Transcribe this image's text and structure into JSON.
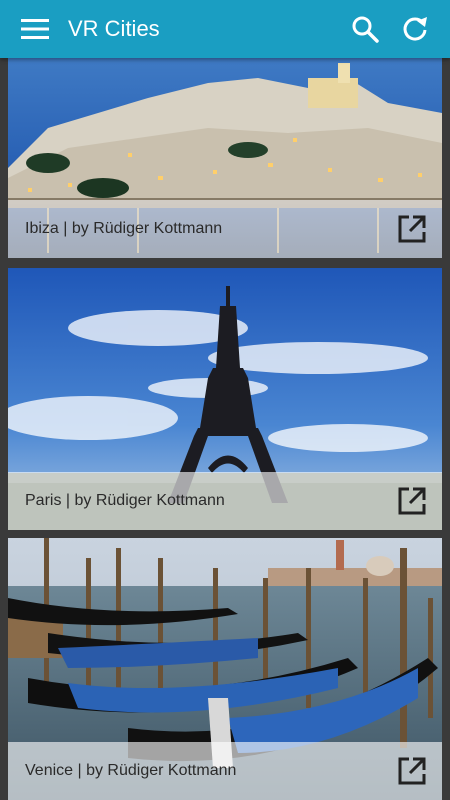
{
  "appbar": {
    "title": "VR Cities",
    "icons": {
      "menu": "hamburger-menu-icon",
      "search": "search-icon",
      "refresh": "refresh-icon"
    },
    "color": "#1a9ec2"
  },
  "cards": [
    {
      "caption": "Ibiza | by Rüdiger Kottmann",
      "icon": "open-external-icon"
    },
    {
      "caption": "Paris | by Rüdiger Kottmann",
      "icon": "open-external-icon"
    },
    {
      "caption": "Venice | by Rüdiger Kottmann",
      "icon": "open-external-icon"
    }
  ]
}
